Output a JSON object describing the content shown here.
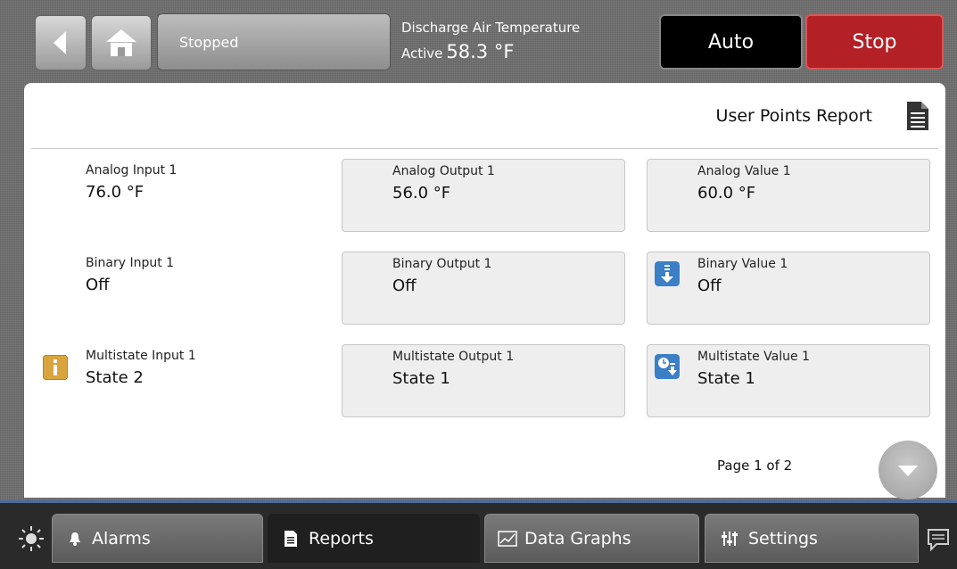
{
  "header": {
    "status_text": "Stopped",
    "point_label": "Discharge Air Temperature",
    "point_state": "Active",
    "point_value": "58.3 °F",
    "auto_label": "Auto",
    "stop_label": "Stop",
    "stop_color": "#b32025"
  },
  "report": {
    "title": "User Points Report",
    "page_label": "Page 1 of 2"
  },
  "points": [
    {
      "name": "Analog Input 1",
      "value": "76.0 °F",
      "icon": ""
    },
    {
      "name": "Analog Output 1",
      "value": "56.0 °F",
      "icon": ""
    },
    {
      "name": "Analog Value 1",
      "value": "60.0 °F",
      "icon": ""
    },
    {
      "name": "Binary Input 1",
      "value": "Off",
      "icon": ""
    },
    {
      "name": "Binary Output 1",
      "value": "Off",
      "icon": ""
    },
    {
      "name": "Binary Value 1",
      "value": "Off",
      "icon": "override-down-icon"
    },
    {
      "name": "Multistate Input 1",
      "value": "State 2",
      "icon": "info-icon"
    },
    {
      "name": "Multistate Output 1",
      "value": "State 1",
      "icon": ""
    },
    {
      "name": "Multistate Value 1",
      "value": "State 1",
      "icon": "schedule-override-icon"
    }
  ],
  "nav": {
    "alarms_label": "Alarms",
    "reports_label": "Reports",
    "data_graphs_label": "Data Graphs",
    "settings_label": "Settings"
  }
}
